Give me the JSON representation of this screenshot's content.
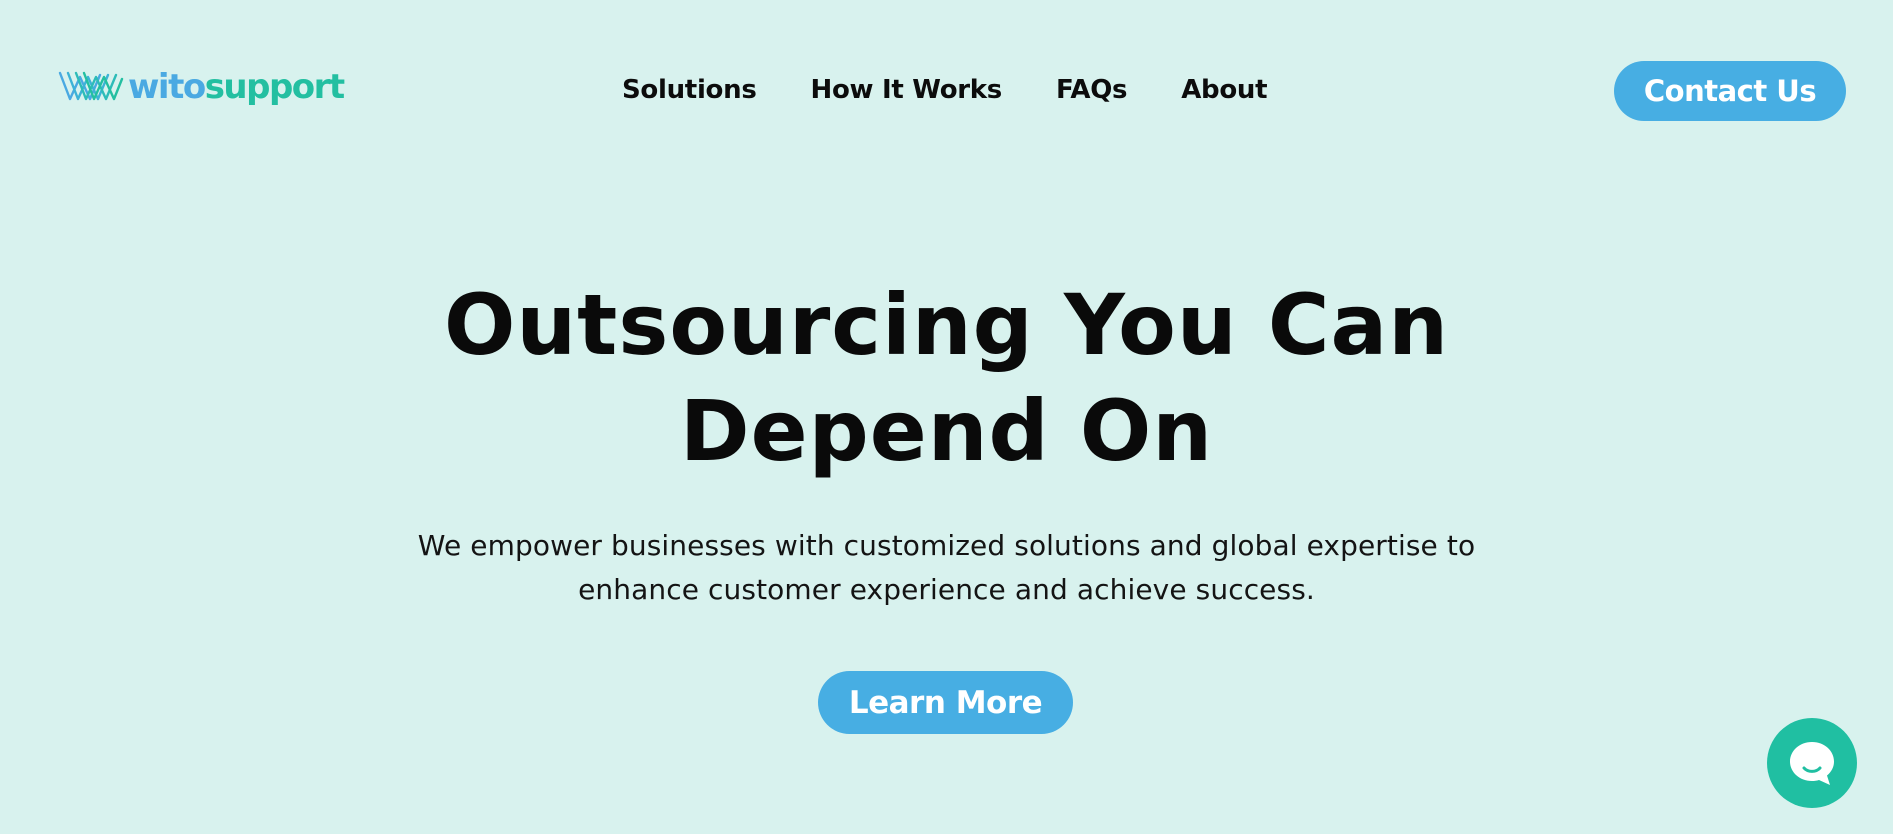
{
  "header": {
    "logo": {
      "part1": "wito",
      "part2": "support",
      "icon": "wito-wave-logo"
    },
    "nav": [
      {
        "label": "Solutions"
      },
      {
        "label": "How It Works"
      },
      {
        "label": "FAQs"
      },
      {
        "label": "About"
      }
    ],
    "contact_label": "Contact Us"
  },
  "hero": {
    "title_line1": "Outsourcing You Can",
    "title_line2": "Depend On",
    "subtitle_line1": "We empower businesses with customized solutions and global expertise to",
    "subtitle_line2": "enhance customer experience and achieve success.",
    "cta_label": "Learn More"
  },
  "chat_widget": {
    "icon": "chat-bubble-icon"
  },
  "colors": {
    "background": "#d8f2ee",
    "primary_blue": "#47aee3",
    "brand_teal": "#20bfa2",
    "text": "#0c0c0c"
  }
}
